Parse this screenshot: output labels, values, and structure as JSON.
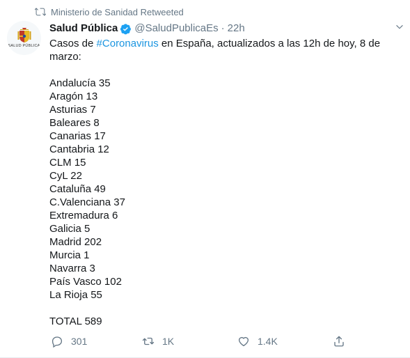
{
  "retweet_context": {
    "icon": "retweet-icon",
    "text": "Ministerio de Sanidad Retweeted"
  },
  "author": {
    "avatar_text": "SALUD PÚBLICA",
    "display_name": "Salud Pública",
    "verified_icon": "verified-badge-icon",
    "handle": "@SaludPublicaEs",
    "separator": "·",
    "time": "22h"
  },
  "tweet": {
    "intro_before": "Casos de ",
    "hashtag": "#Coronavirus",
    "intro_after": " en España, actualizados a las 12h de hoy, 8 de marzo:",
    "lines": [
      "Andalucía 35",
      "Aragón 13",
      "Asturias 7",
      "Baleares 8",
      "Canarias 17",
      "Cantabria 12",
      "CLM 15",
      "CyL 22",
      "Cataluña 49",
      "C.Valenciana 37",
      "Extremadura 6",
      "Galicia 5",
      "Madrid 202",
      "Murcia 1",
      "Navarra 3",
      "País Vasco 102",
      "La Rioja 55"
    ],
    "total": "TOTAL 589"
  },
  "actions": {
    "reply_count": "301",
    "retweet_count": "1K",
    "like_count": "1.4K",
    "share_label": ""
  },
  "colors": {
    "link": "#1b95e0",
    "secondary": "#657786",
    "text": "#14171a",
    "verified": "#1da1f2"
  }
}
